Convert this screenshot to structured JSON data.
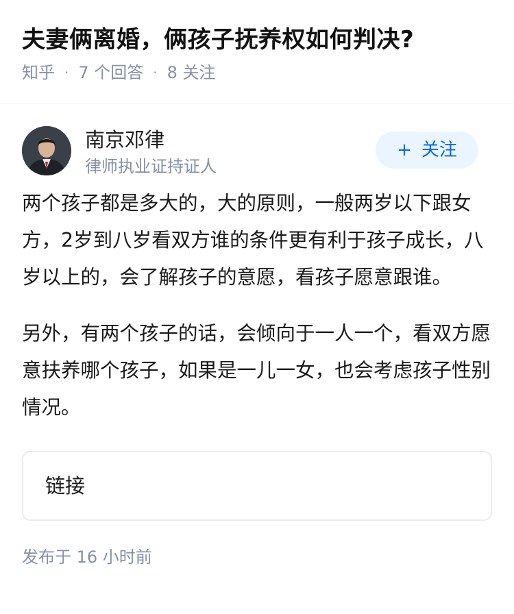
{
  "question": {
    "title": "夫妻俩离婚，俩孩子抚养权如何判决?",
    "source": "知乎",
    "answers": "7 个回答",
    "followers": "8 关注"
  },
  "author": {
    "name": "南京邓律",
    "tag": "律师执业证持证人",
    "follow_plus": "+",
    "follow_label": "关注"
  },
  "answer": {
    "paragraphs": [
      "两个孩子都是多大的，大的原则，一般两岁以下跟女方，2岁到八岁看双方谁的条件更有利于孩子成长，八岁以上的，会了解孩子的意愿，看孩子愿意跟谁。",
      "另外，有两个孩子的话，会倾向于一人一个，看双方愿意扶养哪个孩子，如果是一儿一女，也会考虑孩子性别情况。"
    ],
    "link_label": "链接",
    "published": "发布于 16 小时前"
  }
}
